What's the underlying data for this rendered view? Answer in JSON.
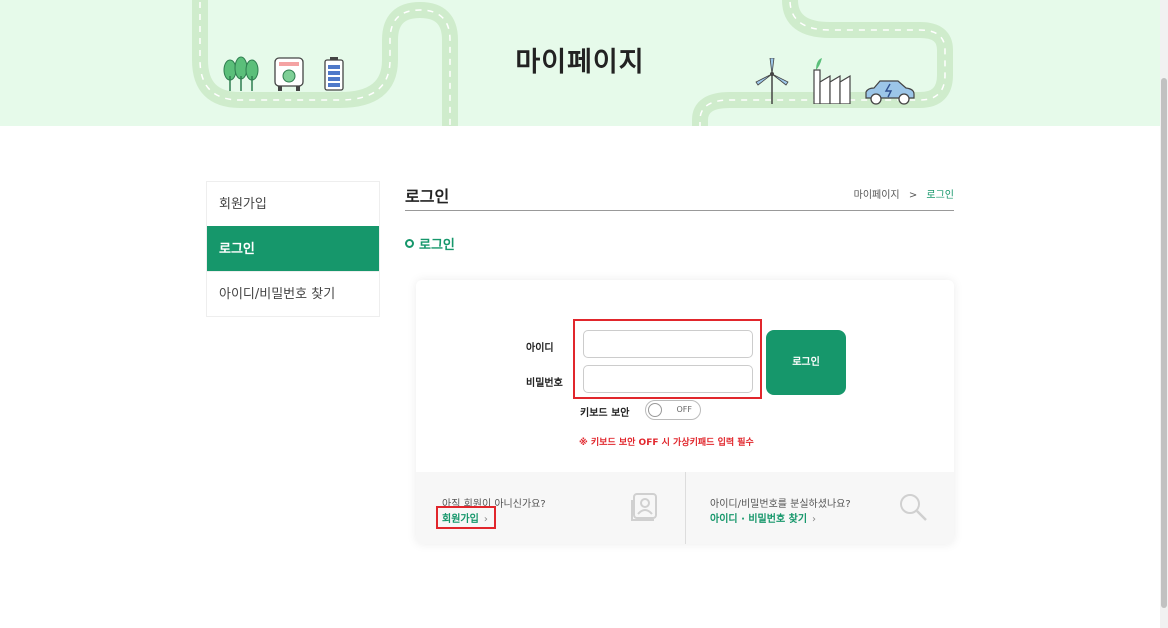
{
  "banner": {
    "title": "마이페이지"
  },
  "sidebar": {
    "items": [
      {
        "label": "회원가입",
        "active": false
      },
      {
        "label": "로그인",
        "active": true
      },
      {
        "label": "아이디/비밀번호 찾기",
        "active": false
      }
    ]
  },
  "content": {
    "title": "로그인",
    "breadcrumb": {
      "parent": "마이페이지",
      "separator": ">",
      "current": "로그인"
    },
    "section_title": "로그인"
  },
  "login": {
    "id_label": "아이디",
    "id_value": "",
    "password_label": "비밀번호",
    "password_value": "",
    "submit_label": "로그인",
    "keyboard_security_label": "키보드 보안",
    "keyboard_security_state": "OFF",
    "notice": "※ 키보드 보안 OFF 시 가상키패드 입력 필수"
  },
  "bottom": {
    "signup_question": "아직 회원이 아니신가요?",
    "signup_link": "회원가입",
    "find_question": "아이디/비밀번호를 분실하셨나요?",
    "find_link": "아이디 · 비밀번호 찾기",
    "arrow": "›"
  },
  "colors": {
    "accent": "#16976b",
    "banner_bg": "#e6faea",
    "highlight": "#e1262c"
  },
  "icons": [
    "tree-icon",
    "bus-icon",
    "battery-icon",
    "wind-turbine-icon",
    "factory-icon",
    "electric-car-icon",
    "user-card-icon",
    "search-icon",
    "ring-bullet-icon"
  ]
}
